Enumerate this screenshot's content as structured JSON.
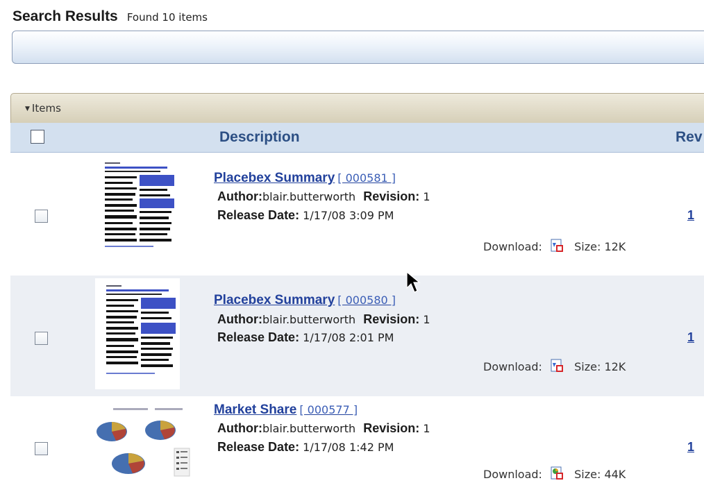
{
  "header": {
    "title": "Search Results",
    "count_text": "Found 10 items"
  },
  "items_panel": {
    "label": "Items"
  },
  "columns": {
    "description": "Description",
    "revision": "Rev"
  },
  "results": [
    {
      "name": "Placebex Summary",
      "id": "[ 000581 ]",
      "author_label": "Author:",
      "author": "blair.butterworth",
      "revision_label": "Revision:",
      "revision": "1",
      "release_label": "Release Date:",
      "release_date": "1/17/08 3:09 PM",
      "download_label": "Download:",
      "download_icon": "pdf-icon",
      "size_label": "Size:",
      "size": "12K",
      "rev_link": "1"
    },
    {
      "name": "Placebex Summary",
      "id": "[ 000580 ]",
      "author_label": "Author:",
      "author": "blair.butterworth",
      "revision_label": "Revision:",
      "revision": "1",
      "release_label": "Release Date:",
      "release_date": "1/17/08 2:01 PM",
      "download_label": "Download:",
      "download_icon": "pdf-icon",
      "size_label": "Size:",
      "size": "12K",
      "rev_link": "1"
    },
    {
      "name": "Market Share",
      "id": "[ 000577 ]",
      "author_label": "Author:",
      "author": "blair.butterworth",
      "revision_label": "Revision:",
      "revision": "1",
      "release_label": "Release Date:",
      "release_date": "1/17/08 1:42 PM",
      "download_label": "Download:",
      "download_icon": "presentation-icon",
      "size_label": "Size:",
      "size": "44K",
      "rev_link": "1"
    }
  ],
  "colors": {
    "link": "#22419c",
    "header_bg": "#d3e0ef",
    "alt_row_bg": "#eceff4"
  }
}
